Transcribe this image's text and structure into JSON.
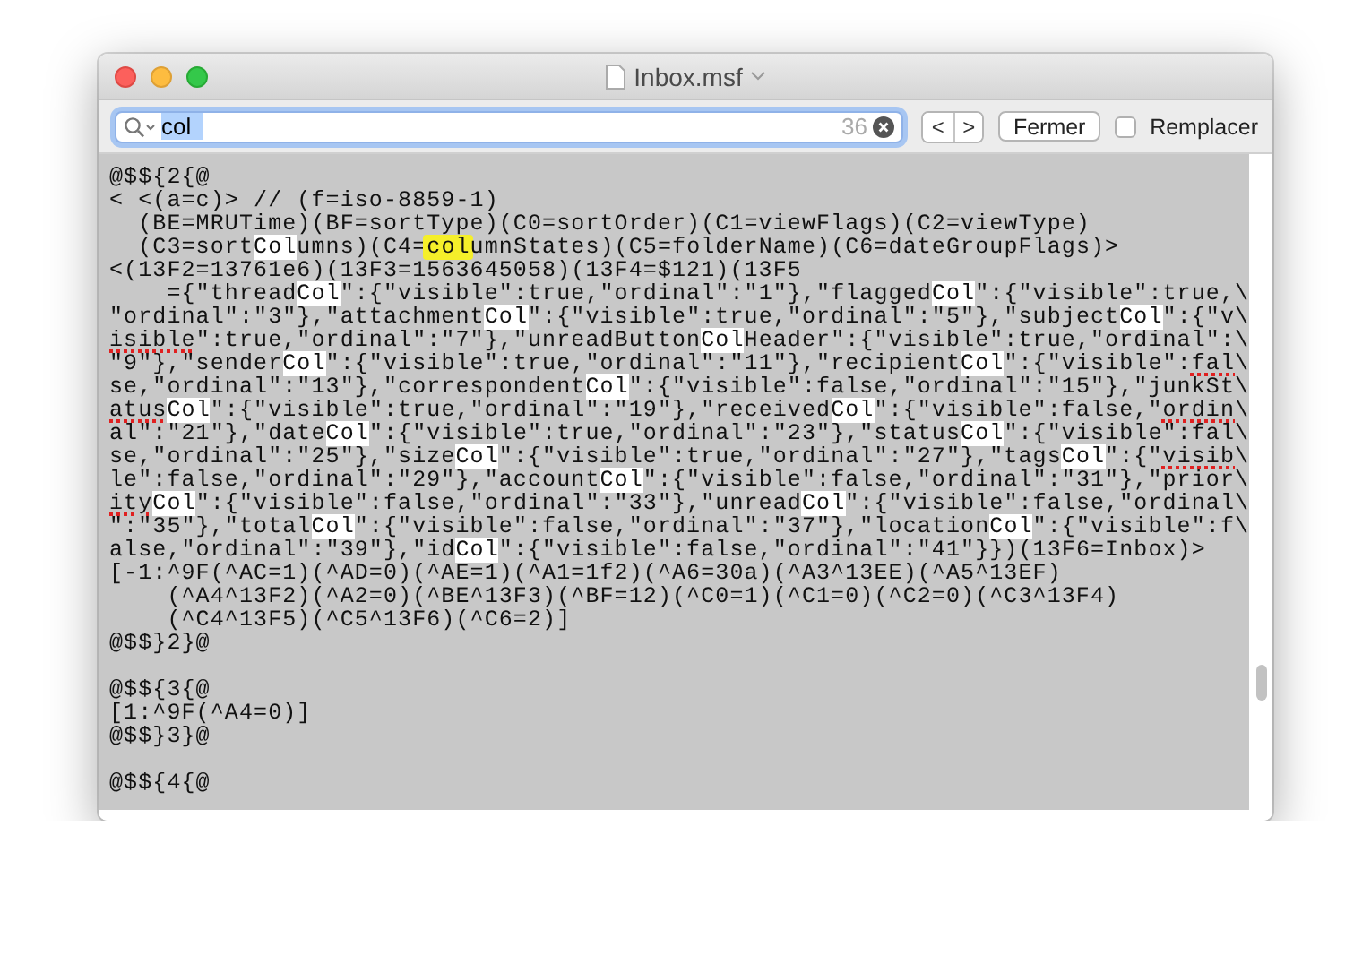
{
  "window": {
    "title": "Inbox.msf"
  },
  "find_bar": {
    "query": "col",
    "query_selected": true,
    "match_count": "36",
    "previous_button": "<",
    "next_button": ">",
    "close_button": "Fermer",
    "replace": {
      "label": "Remplacer",
      "checked": false
    }
  },
  "editor": {
    "blocks": [
      [
        [
          {
            "text": "@$${2{@",
            "kind": "plain"
          }
        ],
        [
          {
            "text": "< <(a=c)> // (f=iso-8859-1)",
            "kind": "plain"
          }
        ],
        [
          {
            "text": "  (BE=MRUTime)(BF=sortType)(C0=sortOrder)(C1=viewFlags)(C2=viewType)",
            "kind": "plain"
          }
        ],
        [
          {
            "text": "  (C3=sort",
            "kind": "plain"
          },
          {
            "text": "Col",
            "kind": "match"
          },
          {
            "text": "umns)(C4=",
            "kind": "plain"
          },
          {
            "text": "col",
            "kind": "current"
          },
          {
            "text": "umnStates)(C5=folderName)(C6=dateGroupFlags)>",
            "kind": "plain"
          }
        ],
        [
          {
            "text": "<(13F2=13761e6)(13F3=1563645058)(13F4=$121)(13F5",
            "kind": "plain"
          }
        ],
        [
          {
            "text": "    ={\"thread",
            "kind": "plain"
          },
          {
            "text": "Col",
            "kind": "match"
          },
          {
            "text": "\":{\"visible\":true,\"ordinal\":\"1\"},\"flagged",
            "kind": "plain"
          },
          {
            "text": "Col",
            "kind": "match"
          },
          {
            "text": "\":{\"visible\":true,\\",
            "kind": "plain"
          }
        ],
        [
          {
            "text": "\"ordinal\":\"3\"},\"attachment",
            "kind": "plain"
          },
          {
            "text": "Col",
            "kind": "match"
          },
          {
            "text": "\":{\"visible\":true,\"ordinal\":\"5\"},\"subject",
            "kind": "plain"
          },
          {
            "text": "Col",
            "kind": "match"
          },
          {
            "text": "\":{\"v\\",
            "kind": "plain"
          }
        ],
        [
          {
            "text": "isible",
            "kind": "misspelled"
          },
          {
            "text": "\":true,\"ordinal\":\"7\"},\"unreadButton",
            "kind": "plain"
          },
          {
            "text": "Col",
            "kind": "match"
          },
          {
            "text": "Header\":{\"visible\":true,\"ordinal\":\\",
            "kind": "plain"
          }
        ],
        [
          {
            "text": "\"9\"},\"sender",
            "kind": "plain"
          },
          {
            "text": "Col",
            "kind": "match"
          },
          {
            "text": "\":{\"visible\":true,\"ordinal\":\"11\"},\"recipient",
            "kind": "plain"
          },
          {
            "text": "Col",
            "kind": "match"
          },
          {
            "text": "\":{\"visible\":",
            "kind": "plain"
          },
          {
            "text": "fal",
            "kind": "misspelled"
          },
          {
            "text": "\\",
            "kind": "plain"
          }
        ],
        [
          {
            "text": "se,\"ordinal\":\"13\"},\"correspondent",
            "kind": "plain"
          },
          {
            "text": "Col",
            "kind": "match"
          },
          {
            "text": "\":{\"visible\":false,\"ordinal\":\"15\"},\"junkSt\\",
            "kind": "plain"
          }
        ],
        [
          {
            "text": "atus",
            "kind": "misspelled"
          },
          {
            "text": "Col",
            "kind": "match"
          },
          {
            "text": "\":{\"visible\":true,\"ordinal\":\"19\"},\"received",
            "kind": "plain"
          },
          {
            "text": "Col",
            "kind": "match"
          },
          {
            "text": "\":{\"visible\":false,\"",
            "kind": "plain"
          },
          {
            "text": "ordin",
            "kind": "misspelled"
          },
          {
            "text": "\\",
            "kind": "plain"
          }
        ],
        [
          {
            "text": "al\":\"21\"},\"date",
            "kind": "plain"
          },
          {
            "text": "Col",
            "kind": "match"
          },
          {
            "text": "\":{\"visible\":true,\"ordinal\":\"23\"},\"status",
            "kind": "plain"
          },
          {
            "text": "Col",
            "kind": "match"
          },
          {
            "text": "\":{\"visible\":fal\\",
            "kind": "plain"
          }
        ],
        [
          {
            "text": "se,\"ordinal\":\"25\"},\"size",
            "kind": "plain"
          },
          {
            "text": "Col",
            "kind": "match"
          },
          {
            "text": "\":{\"visible\":true,\"ordinal\":\"27\"},\"tags",
            "kind": "plain"
          },
          {
            "text": "Col",
            "kind": "match"
          },
          {
            "text": "\":{\"",
            "kind": "plain"
          },
          {
            "text": "visib",
            "kind": "misspelled"
          },
          {
            "text": "\\",
            "kind": "plain"
          }
        ],
        [
          {
            "text": "le\":false,\"ordinal\":\"29\"},\"account",
            "kind": "plain"
          },
          {
            "text": "Col",
            "kind": "match"
          },
          {
            "text": "\":{\"visible\":false,\"ordinal\":\"31\"},\"prior\\",
            "kind": "plain"
          }
        ],
        [
          {
            "text": "ity",
            "kind": "misspelled"
          },
          {
            "text": "Col",
            "kind": "match"
          },
          {
            "text": "\":{\"visible\":false,\"ordinal\":\"33\"},\"unread",
            "kind": "plain"
          },
          {
            "text": "Col",
            "kind": "match"
          },
          {
            "text": "\":{\"visible\":false,\"ordinal\\",
            "kind": "plain"
          }
        ],
        [
          {
            "text": "\":\"35\"},\"total",
            "kind": "plain"
          },
          {
            "text": "Col",
            "kind": "match"
          },
          {
            "text": "\":{\"visible\":false,\"ordinal\":\"37\"},\"location",
            "kind": "plain"
          },
          {
            "text": "Col",
            "kind": "match"
          },
          {
            "text": "\":{\"visible\":f\\",
            "kind": "plain"
          }
        ],
        [
          {
            "text": "alse,\"ordinal\":\"39\"},\"id",
            "kind": "plain"
          },
          {
            "text": "Col",
            "kind": "match"
          },
          {
            "text": "\":{\"visible\":false,\"ordinal\":\"41\"}})(13F6=Inbox)>",
            "kind": "plain"
          }
        ],
        [
          {
            "text": "[-1:^9F(^AC=1)(^AD=0)(^AE=1)(^A1=1f2)(^A6=30a)(^A3^13EE)(^A5^13EF)",
            "kind": "plain"
          }
        ],
        [
          {
            "text": "    (^A4^13F2)(^A2=0)(^BE^13F3)(^BF=12)(^C0=1)(^C1=0)(^C2=0)(^C3^13F4)",
            "kind": "plain"
          }
        ],
        [
          {
            "text": "    (^C4^13F5)(^C5^13F6)(^C6=2)]",
            "kind": "plain"
          }
        ],
        [
          {
            "text": "@$$}2}@",
            "kind": "plain"
          }
        ]
      ],
      [
        [
          {
            "text": "@$${3{@",
            "kind": "plain"
          }
        ],
        [
          {
            "text": "[1:^9F(^A4=0)]",
            "kind": "plain"
          }
        ],
        [
          {
            "text": "@$$}3}@",
            "kind": "plain"
          }
        ]
      ],
      [
        [
          {
            "text": "@$${4{@",
            "kind": "plain"
          }
        ]
      ]
    ]
  }
}
